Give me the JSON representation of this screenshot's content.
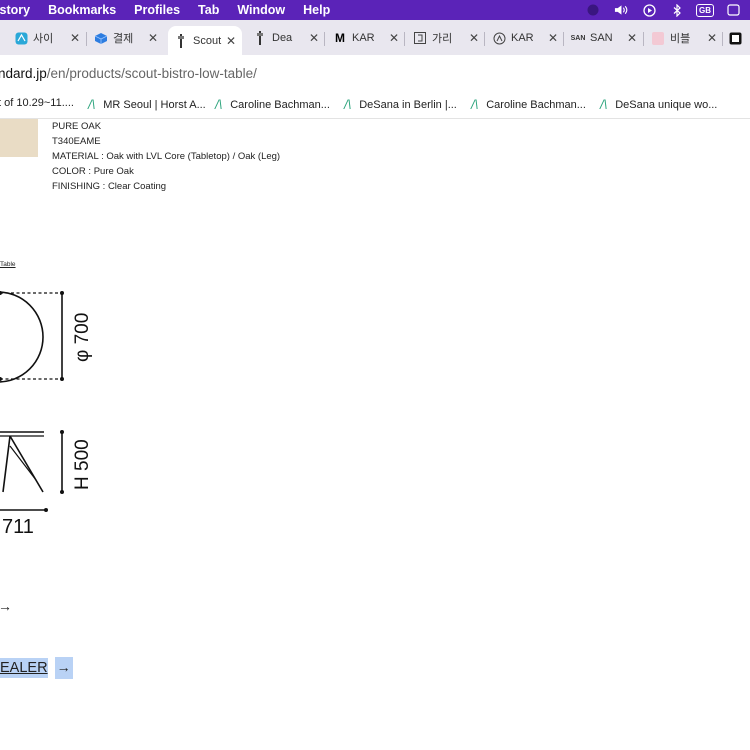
{
  "menu_bar": {
    "items": [
      "History",
      "Bookmarks",
      "Profiles",
      "Tab",
      "Window",
      "Help"
    ],
    "status_icons": [
      "account-icon",
      "volume-icon",
      "play-icon",
      "bluetooth-icon",
      "keyboard-icon",
      "control-center-icon"
    ],
    "keyboard_badge": "GB"
  },
  "tabs": [
    {
      "label": "사이",
      "icon": "app-icon"
    },
    {
      "label": "결제",
      "icon": "cube-icon"
    },
    {
      "label": "Scout",
      "icon": "lamp-icon",
      "active": true
    },
    {
      "label": "Dea",
      "icon": "lamp-icon"
    },
    {
      "label": "KAR",
      "icon": "m-logo-icon"
    },
    {
      "label": "가리",
      "icon": "bracket-icon"
    },
    {
      "label": "KAR",
      "icon": "badge-icon"
    },
    {
      "label": "SAN",
      "icon": "sanu-icon"
    },
    {
      "label": "비블",
      "icon": "pink-icon"
    },
    {
      "label": "",
      "icon": "square-icon"
    }
  ],
  "address": {
    "domain": "ndard.jp",
    "path": "/en/products/scout-bistro-low-table/"
  },
  "bookmarks": [
    {
      "label": "t of 10.29~11...."
    },
    {
      "label": "MR Seoul | Horst A..."
    },
    {
      "label": "Caroline Bachman..."
    },
    {
      "label": "DeSana in Berlin |..."
    },
    {
      "label": "Caroline Bachman..."
    },
    {
      "label": "DeSana unique wo..."
    }
  ],
  "product": {
    "spec_lines": [
      "PURE OAK",
      "T340EAME",
      "MATERIAL : Oak with LVL Core (Tabletop) / Oak (Leg)",
      "COLOR : Pure Oak",
      "FINISHING : Clear Coating"
    ],
    "tiny_link": "Table"
  },
  "drawing": {
    "diameter_label": "φ 700",
    "height_label": "H 500",
    "width_label": "711"
  },
  "dealer": {
    "label": "EALER",
    "arrow": "→"
  },
  "standalone_arrow": "→"
}
